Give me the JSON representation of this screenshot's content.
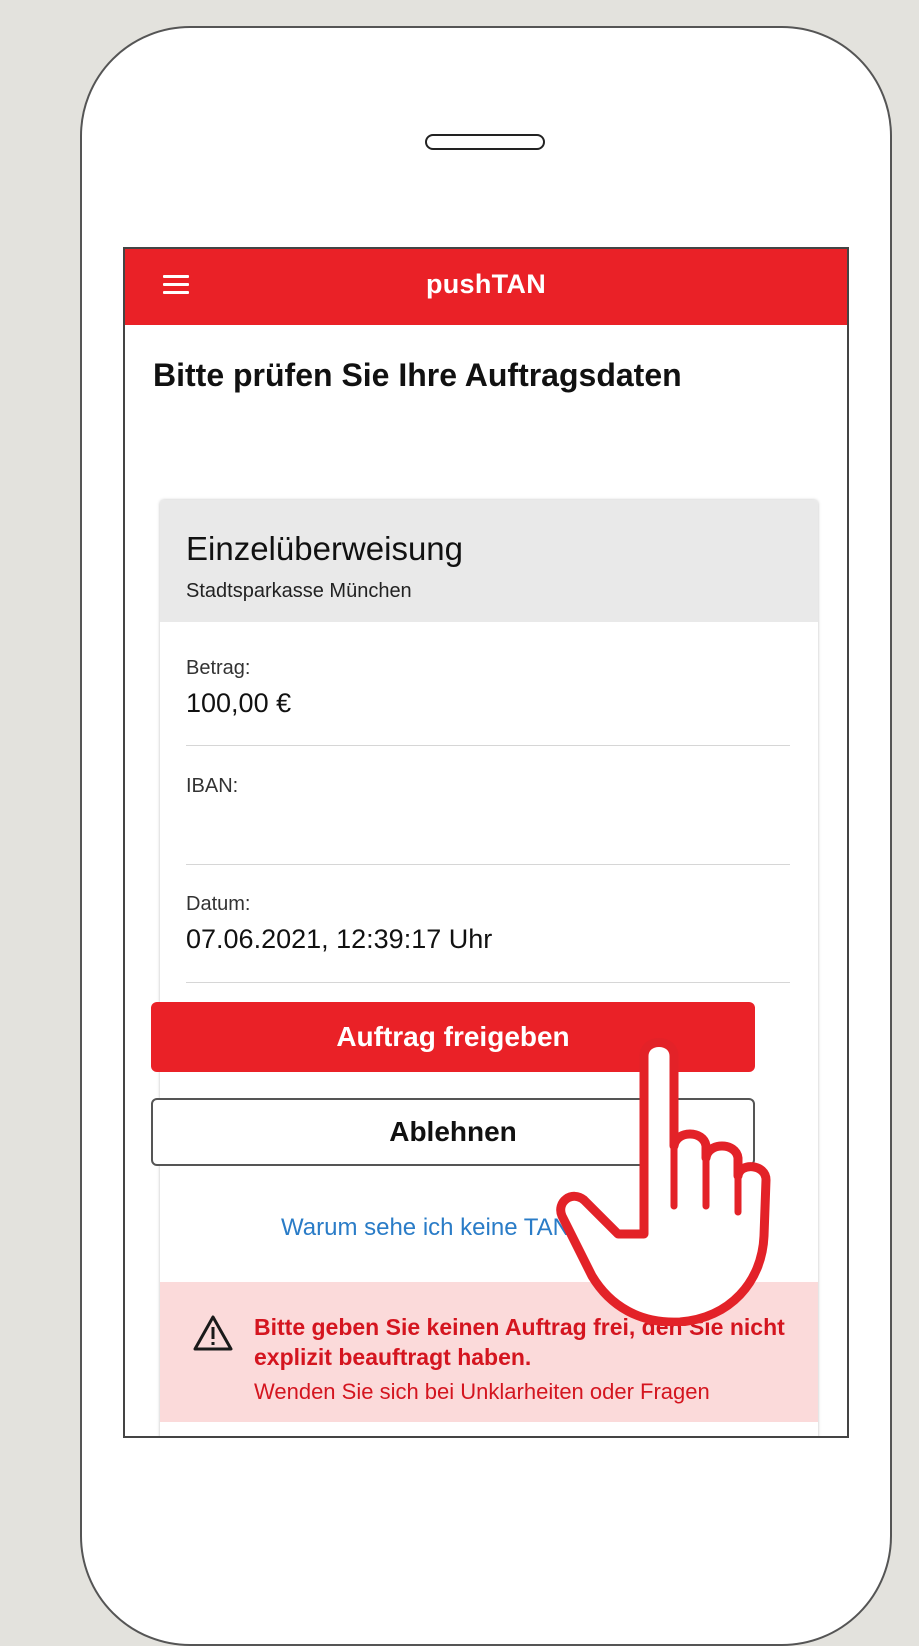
{
  "app": {
    "title": "pushTAN"
  },
  "icons": {
    "menu": "hamburger-menu-icon",
    "warning": "warning-triangle-icon",
    "pointer": "pointing-hand-icon"
  },
  "colors": {
    "brand_red": "#ea2127",
    "link_blue": "#2a7cc7",
    "warning_bg": "#fbdada",
    "warning_text": "#d4151f"
  },
  "page": {
    "heading": "Bitte prüfen Sie Ihre Auftragsdaten"
  },
  "order": {
    "type": "Einzelüberweisung",
    "bank": "Stadtsparkasse München",
    "fields": [
      {
        "label": "Betrag:",
        "value": "100,00 €"
      },
      {
        "label": "IBAN:",
        "value": ""
      },
      {
        "label": "Datum:",
        "value": "07.06.2021, 12:39:17 Uhr"
      }
    ]
  },
  "actions": {
    "approve": "Auftrag freigeben",
    "reject": "Ablehnen",
    "help_link": "Warum sehe ich keine TAN?"
  },
  "warning": {
    "title": "Bitte geben Sie keinen Auftrag frei, den Sie nicht explizit beauftragt haben.",
    "body": "Wenden Sie sich bei Unklarheiten oder Fragen"
  }
}
